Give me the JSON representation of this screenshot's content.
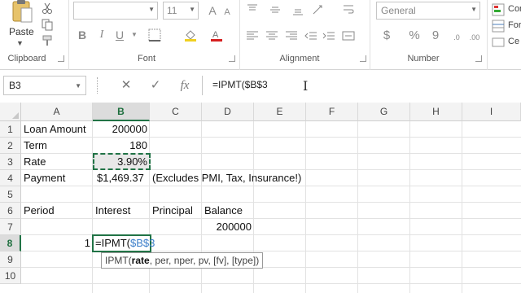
{
  "ribbon": {
    "clipboard": {
      "paste_label": "Paste",
      "group_label": "Clipboard"
    },
    "font": {
      "group_label": "Font",
      "font_size": "11",
      "bold": "B",
      "italic": "I",
      "underline": "U"
    },
    "alignment": {
      "group_label": "Alignment"
    },
    "number": {
      "group_label": "Number",
      "format": "General",
      "currency": "$",
      "percent": "%",
      "comma": "9"
    },
    "styles": {
      "cond_format": "Con",
      "format_table": "For",
      "cell_styles": "Ce"
    }
  },
  "formula_bar": {
    "name_box": "B3",
    "cancel": "✕",
    "enter": "✓",
    "fx": "fx",
    "formula": "=IPMT($B$3"
  },
  "grid": {
    "columns": [
      "A",
      "B",
      "C",
      "D",
      "E",
      "F",
      "G",
      "H",
      "I"
    ],
    "active_column": "B",
    "rows": [
      "1",
      "2",
      "3",
      "4",
      "5",
      "6",
      "7",
      "8",
      "9",
      "10"
    ],
    "active_row": "8",
    "cells": {
      "A1": "Loan Amount",
      "B1": "200000",
      "A2": "Term",
      "B2": "180",
      "A3": "Rate",
      "B3": "3.90%",
      "A4": "Payment",
      "B4": "$1,469.37",
      "C4": "(Excludes PMI, Tax, Insurance!)",
      "A6": "Period",
      "B6": "Interest",
      "C6": "Principal",
      "D6": "Balance",
      "D7": "200000",
      "A8": "1"
    },
    "editing": {
      "prefix": "=IPMT(",
      "reference": "$B$3"
    },
    "tooltip": {
      "prefix": "IPMT(",
      "current_arg": "rate",
      "rest": ", per, nper, pv, [fv], [type])"
    }
  },
  "colors": {
    "accent": "#217346",
    "reference": "#3a7dc9"
  }
}
